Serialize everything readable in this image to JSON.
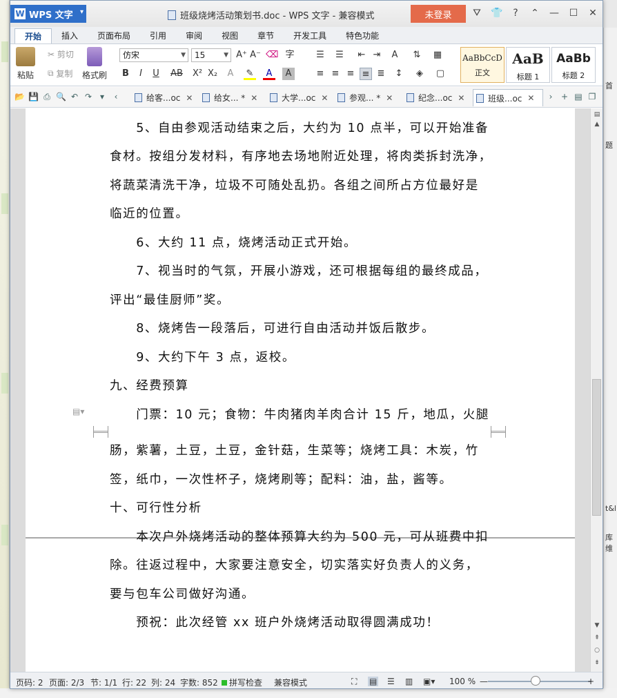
{
  "titlebar": {
    "app_label": "WPS 文字",
    "document_title": "班级烧烤活动策划书.doc - WPS 文字 - 兼容模式",
    "login_label": "未登录"
  },
  "ribbon": {
    "tabs": [
      "开始",
      "插入",
      "页面布局",
      "引用",
      "审阅",
      "视图",
      "章节",
      "开发工具",
      "特色功能"
    ],
    "paste_label": "粘贴",
    "cut_label": "剪切",
    "copy_label": "复制",
    "format_painter_label": "格式刷",
    "font_name": "仿宋",
    "font_size": "15",
    "styles": [
      {
        "sample": "AaBbCcD",
        "label": "正文"
      },
      {
        "sample": "AaB",
        "label": "标题 1"
      },
      {
        "sample": "AaBb",
        "label": "标题 2"
      }
    ]
  },
  "doc_tabs": [
    {
      "label": "给客...oc",
      "active": false
    },
    {
      "label": "给女... *",
      "active": false
    },
    {
      "label": "大学...oc",
      "active": false
    },
    {
      "label": "参观... *",
      "active": false
    },
    {
      "label": "纪念...oc",
      "active": false
    },
    {
      "label": "班级...oc",
      "active": true
    }
  ],
  "document": {
    "lines": [
      "　　5、自由参观活动结束之后，大约为 10 点半，可以开始准备",
      "食材。按组分发材料，有序地去场地附近处理，将肉类拆封洗净，",
      "将蔬菜清洗干净，垃圾不可随处乱扔。各组之间所占方位最好是",
      "临近的位置。",
      "　　6、大约 11 点，烧烤活动正式开始。",
      "　　7、视当时的气氛，开展小游戏，还可根据每组的最终成品，",
      "评出“最佳厨师”奖。",
      "　　8、烧烤告一段落后，可进行自由活动并饭后散步。",
      "　　9、大约下午 3 点，返校。",
      "九、经费预算",
      "　　门票：10 元；食物：牛肉猪肉羊肉合计 15 斤，地瓜，火腿",
      "肠，紫薯，土豆，土豆，金针菇，生菜等；烧烤工具：木炭，竹",
      "签，纸巾，一次性杯子，烧烤刷等；配料：油，盐，酱等。",
      "十、可行性分析",
      "　　本次户外烧烤活动的整体预算大约为 500 元，可从班费中扣",
      "除。往返过程中，大家要注意安全，切实落实好负责人的义务，",
      "要与包车公司做好沟通。",
      "　　预祝：此次经管 xx 班户外烧烤活动取得圆满成功！"
    ]
  },
  "statusbar": {
    "page_code": "页码: 2",
    "pages": "页面: 2/3",
    "section": "节: 1/1",
    "row": "行: 22",
    "column": "列: 24",
    "word_count": "字数: 852",
    "spell_check": "拼写检查",
    "compat_mode": "兼容模式",
    "zoom": "100 %"
  },
  "background": {
    "right_snippets": [
      "首",
      "题",
      "t&l",
      "库维"
    ]
  },
  "colors": {
    "app_blue": "#2f6fc9",
    "login_red": "#e46a4a",
    "spell_green": "#2bbd2b"
  }
}
